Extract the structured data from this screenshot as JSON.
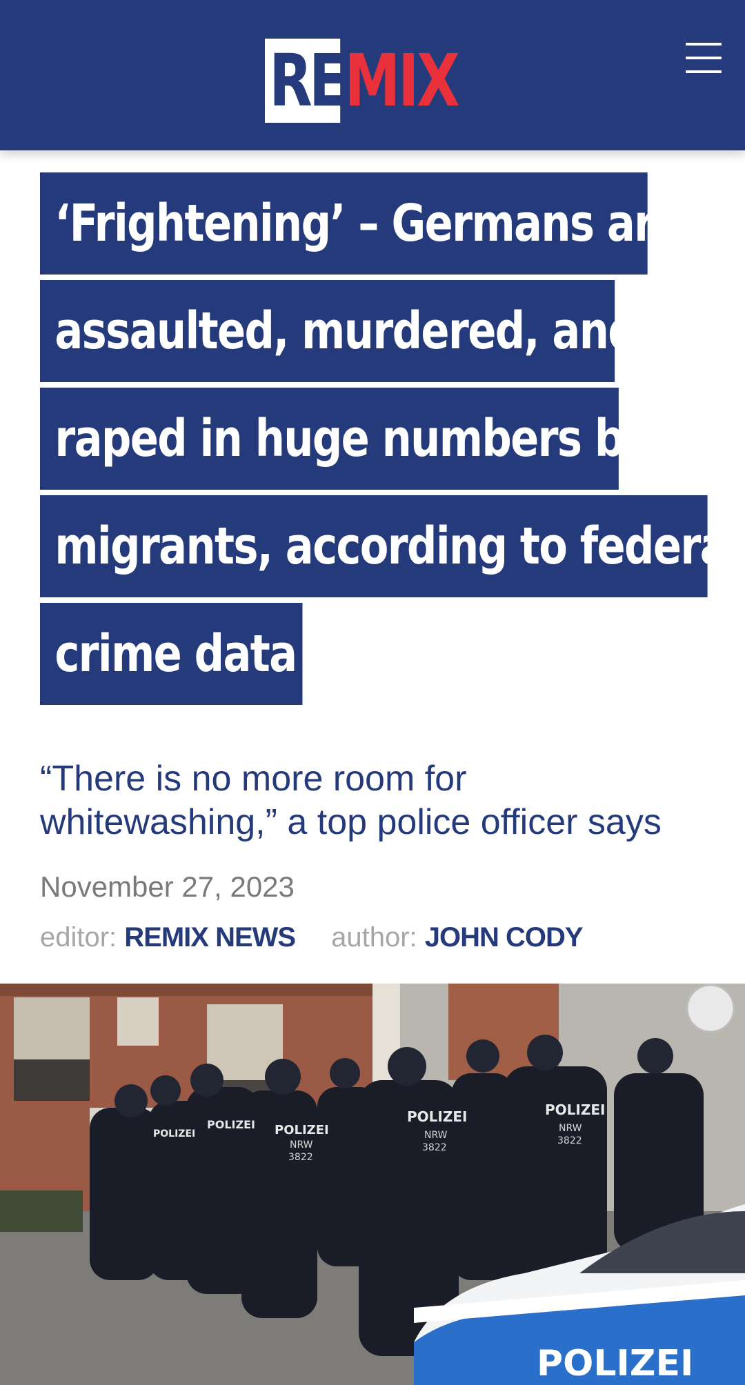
{
  "header": {
    "logo_re": "RE",
    "logo_mix": "MIX",
    "menu_icon": "hamburger-menu-icon",
    "colors": {
      "brand_blue": "#253a7b",
      "brand_red": "#e8313a"
    }
  },
  "article": {
    "title_lines": [
      "‘Frightening’ – Germans are",
      "assaulted, murdered, and",
      "raped in huge numbers by",
      "migrants, according to federal",
      "crime data"
    ],
    "subtitle": "“There is no more room for whitewashing,” a top police officer says",
    "date": "November 27, 2023",
    "editor_label": "editor:",
    "editor_name": "REMIX NEWS",
    "author_label": "author:",
    "author_name": "JOHN CODY"
  },
  "photo": {
    "vest_text": "POLIZEI",
    "vest_sub": "NRW",
    "vest_num": "3822",
    "car_text": "POLIZEI"
  }
}
